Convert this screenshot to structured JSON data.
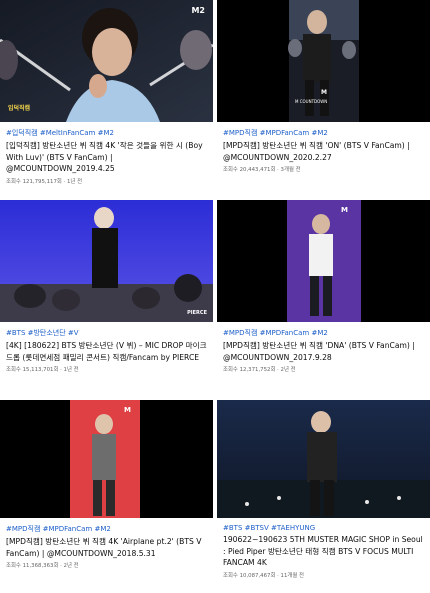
{
  "cards": [
    {
      "hashtags": "#입덕직캠 #MeltInFanCam #M2",
      "title": "[입덕직캠] 방탄소년단 뷔 직캠 4K '작은 것들을 위한 시 (Boy With Luv)' (BTS V FanCam) | @MCOUNTDOWN_2019.4.25",
      "meta": "조회수 121,795,117회 · 1년 전",
      "thumb_logo": "M2",
      "thumb_text": "입덕직캠"
    },
    {
      "hashtags": "#MPD직캠 #MPDFanCam #M2",
      "title": "[MPD직캠] 방탄소년단 뷔 직캠 'ON' (BTS V FanCam) | @MCOUNTDOWN_2020.2.27",
      "meta": "조회수 20,443,471회 · 3개월 전",
      "thumb_logo": "M",
      "thumb_text": "M COUNTDOWN"
    },
    {
      "hashtags": "#BTS #방탄소년단 #V",
      "title": "[4K] [180622] BTS 방탄소년단 (V 뷔) – MIC DROP 마이크 드롭 (롯데면세점 패밀리 콘서트) 직캠/Fancam by PIERCE",
      "meta": "조회수 15,113,701회 · 1년 전",
      "thumb_logo": "",
      "thumb_text": "PIERCE"
    },
    {
      "hashtags": "#MPD직캠 #MPDFanCam #M2",
      "title": "[MPD직캠] 방탄소년단 뷔 직캠 'DNA' (BTS V FanCam) | @MCOUNTDOWN_2017.9.28",
      "meta": "조회수 12,371,752회 · 2년 전",
      "thumb_logo": "M",
      "thumb_text": ""
    },
    {
      "hashtags": "#MPD직캠 #MPDFanCam #M2",
      "title": "[MPD직캠] 방탄소년단 뷔 직캠 4K 'Airplane pt.2' (BTS V FanCam) | @MCOUNTDOWN_2018.5.31",
      "meta": "조회수 11,368,363회 · 2년 전",
      "thumb_logo": "M",
      "thumb_text": ""
    },
    {
      "hashtags": "#BTS #BTSV #TAEHYUNG",
      "title": "190622~190623 5TH MUSTER MAGIC SHOP in Seoul : Pied Piper 방탄소년단 태형 직캠 BTS V FOCUS MULTI FANCAM 4K",
      "meta": "조회수 10,087,467회 · 11개월 전",
      "thumb_logo": "",
      "thumb_text": ""
    }
  ],
  "colors": {
    "hashtag": "#1e5fc9",
    "meta": "#666666",
    "title": "#0b0b0b"
  }
}
